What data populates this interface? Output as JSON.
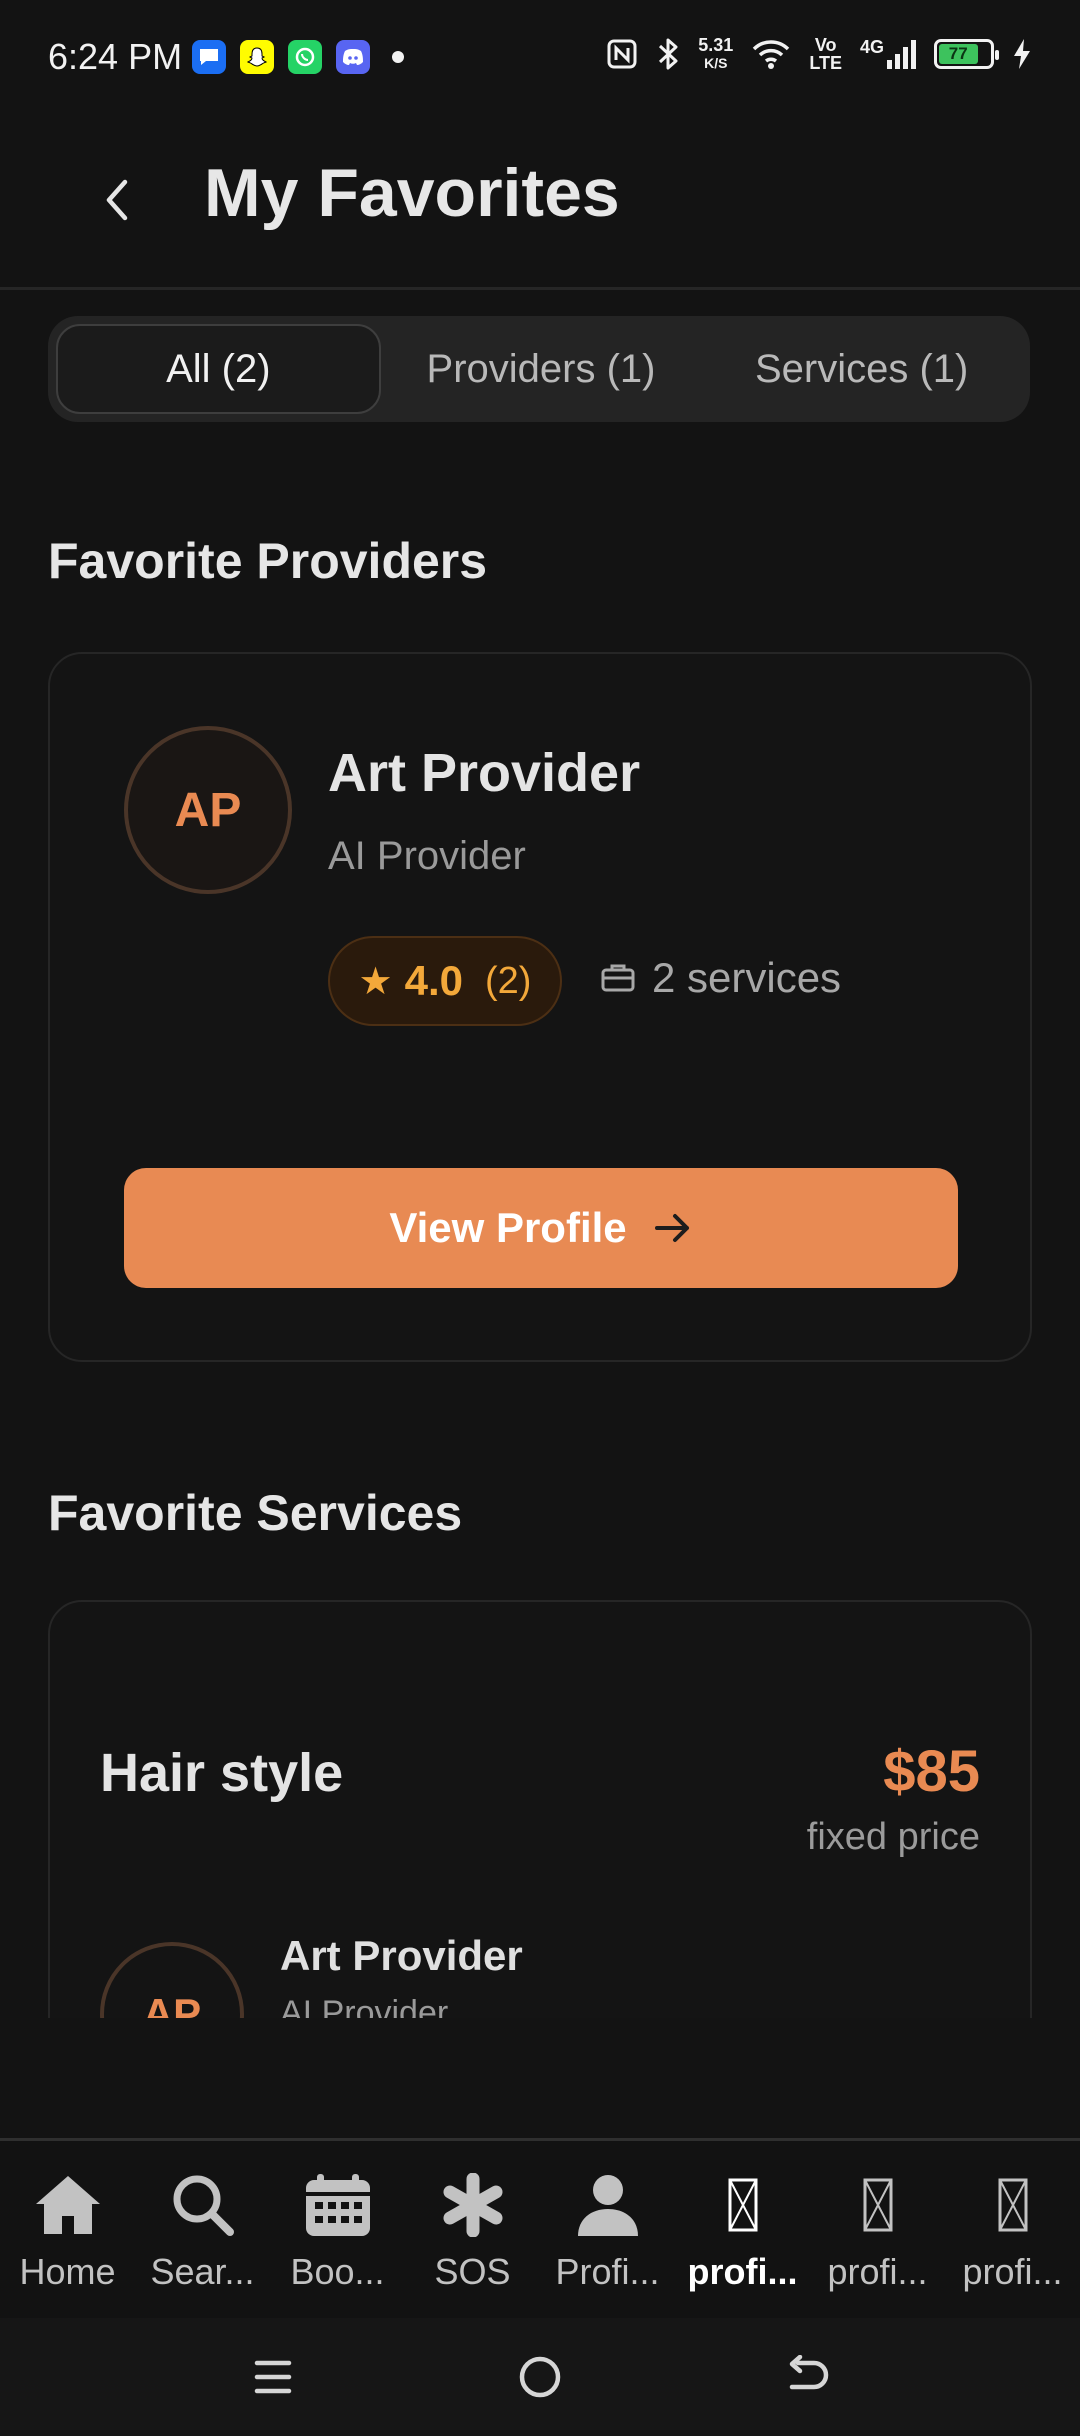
{
  "status_bar": {
    "time": "6:24 PM",
    "net_speed_value": "5.31",
    "net_speed_unit": "K/S",
    "volte_top": "Vo",
    "volte_bottom": "LTE",
    "network": "4G",
    "battery": "77",
    "battery_level": 0.77
  },
  "header": {
    "title": "My Favorites"
  },
  "tabs": [
    {
      "label": "All (2)",
      "active": true
    },
    {
      "label": "Providers (1)",
      "active": false
    },
    {
      "label": "Services (1)",
      "active": false
    }
  ],
  "providers_section": {
    "title": "Favorite Providers",
    "provider": {
      "initials": "AP",
      "name": "Art Provider",
      "role": "AI Provider",
      "rating": "4.0",
      "rating_count": "(2)",
      "services": "2 services",
      "button_label": "View Profile"
    }
  },
  "services_section": {
    "title": "Favorite Services",
    "service": {
      "name": "Hair style",
      "price": "$85",
      "price_type": "fixed price",
      "provider_initials": "AP",
      "provider_name": "Art Provider",
      "provider_role": "AI Provider"
    }
  },
  "bottom_nav": [
    {
      "label": "Home",
      "icon": "home-icon"
    },
    {
      "label": "Sear...",
      "icon": "search-icon"
    },
    {
      "label": "Boo...",
      "icon": "calendar-icon"
    },
    {
      "label": "SOS",
      "icon": "asterisk-icon"
    },
    {
      "label": "Profi...",
      "icon": "person-icon"
    },
    {
      "label": "profi...",
      "icon": "missing-glyph-icon",
      "active": true
    },
    {
      "label": "profi...",
      "icon": "missing-glyph-icon"
    },
    {
      "label": "profi...",
      "icon": "missing-glyph-icon"
    }
  ],
  "colors": {
    "accent": "#e88a53",
    "rating": "#f3a83a",
    "background": "#131313"
  }
}
